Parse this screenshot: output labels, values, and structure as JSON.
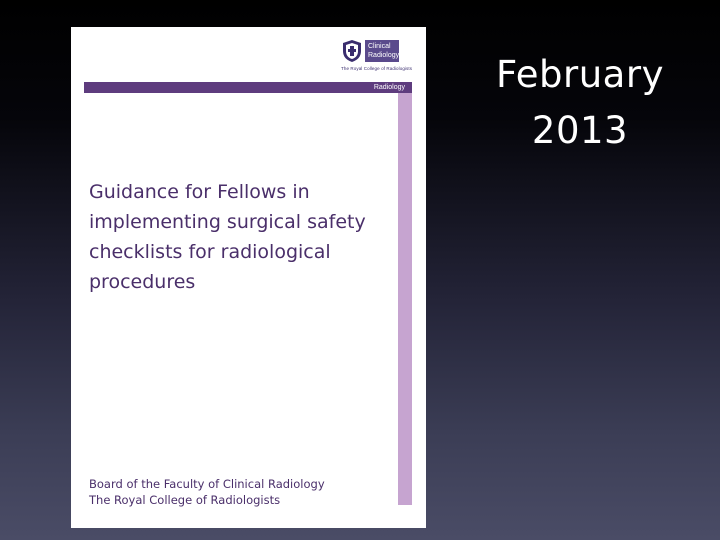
{
  "date": {
    "month": "February",
    "year": "2013"
  },
  "cover": {
    "logo": {
      "icon": "college-crest-icon",
      "box_line1": "Clinical",
      "box_line2": "Radiology",
      "tagline": "The Royal College of Radiologists"
    },
    "band_label": "Radiology",
    "title_lines": [
      "Guidance for Fellows in",
      "implementing surgical safety",
      "checklists for radiological",
      "procedures"
    ],
    "publisher_lines": [
      "Board of the Faculty of Clinical Radiology",
      "The Royal College of Radiologists"
    ],
    "colors": {
      "band": "#5e3c7e",
      "strip": "#c6a4d0",
      "title_text": "#4a2f6a",
      "logo_box": "#5a4a8c"
    }
  }
}
